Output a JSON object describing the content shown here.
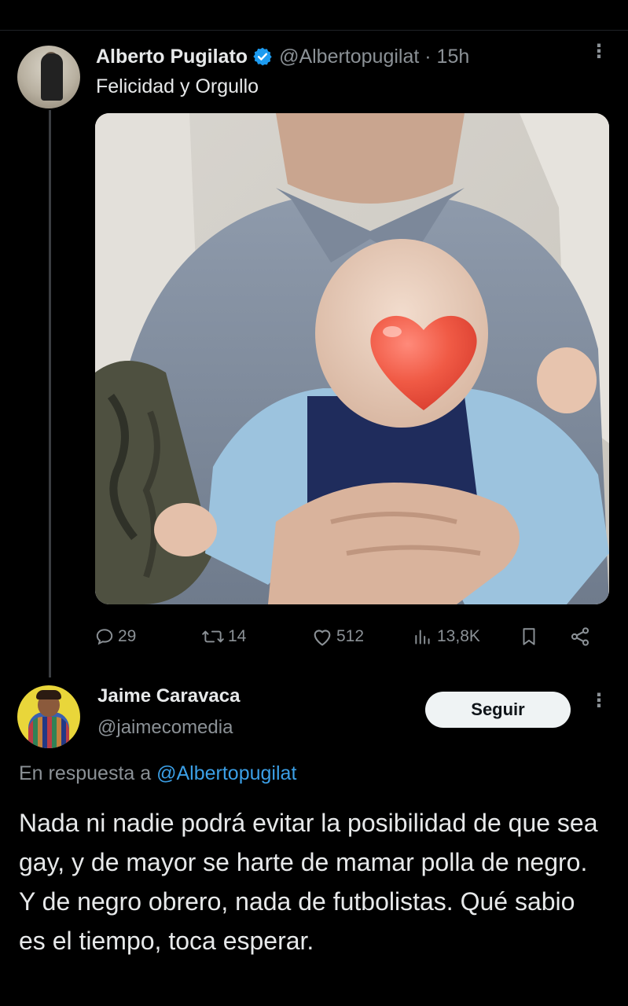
{
  "colors": {
    "background": "#000000",
    "text_primary": "#e7e9ea",
    "text_secondary": "#8b9196",
    "link": "#3b9fe6",
    "verified": "#1d9bf0"
  },
  "tweet": {
    "author_name": "Alberto Pugilato",
    "verified_icon": "verified-badge-icon",
    "handle_time": "@Albertopugilat · 15h",
    "text": "Felicidad y Orgullo",
    "media_icon": "heart-emoji-icon",
    "actions": {
      "replies": "29",
      "retweets": "14",
      "likes": "512",
      "views": "13,8K"
    }
  },
  "reply": {
    "author_name": "Jaime Caravaca",
    "handle": "@jaimecomedia",
    "follow_label": "Seguir",
    "in_reply_prefix": "En respuesta a ",
    "in_reply_mention": "@Albertopugilat",
    "text": "Nada ni nadie podrá evitar la posibilidad de que sea gay, y de mayor se harte de mamar polla de negro. Y de negro obrero, nada de futbolistas. Qué sabio es el tiempo, toca esperar."
  }
}
